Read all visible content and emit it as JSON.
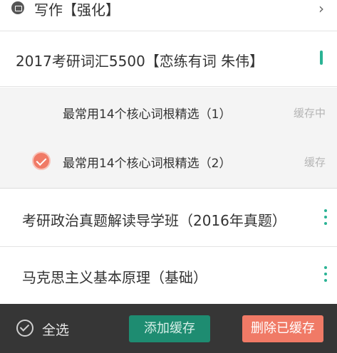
{
  "top_row": {
    "title": "写作【强化】",
    "chevron": "›"
  },
  "course_header": {
    "title": "2017考研词汇5500【恋练有词 朱伟】"
  },
  "lessons": [
    {
      "title": "最常用14个核心词根精选（1）",
      "status": "缓存中",
      "checked": false
    },
    {
      "title": "最常用14个核心词根精选（2）",
      "status": "缓存",
      "checked": true
    }
  ],
  "courses": [
    {
      "title": "考研政治真题解读导学班（2016年真题）",
      "menu_icon": "vertical-dots-icon"
    },
    {
      "title": "马克思主义基本原理（基础）",
      "menu_icon": "vertical-dots-icon"
    }
  ],
  "bottom_bar": {
    "select_all_label": "全选",
    "add_button": "添加缓存",
    "delete_button": "删除已缓存"
  },
  "colors": {
    "accent_green": "#2ab394",
    "add_button_bg": "#1e8c71",
    "delete_button_bg": "#f07a66",
    "bottom_bar_bg": "#363636"
  }
}
